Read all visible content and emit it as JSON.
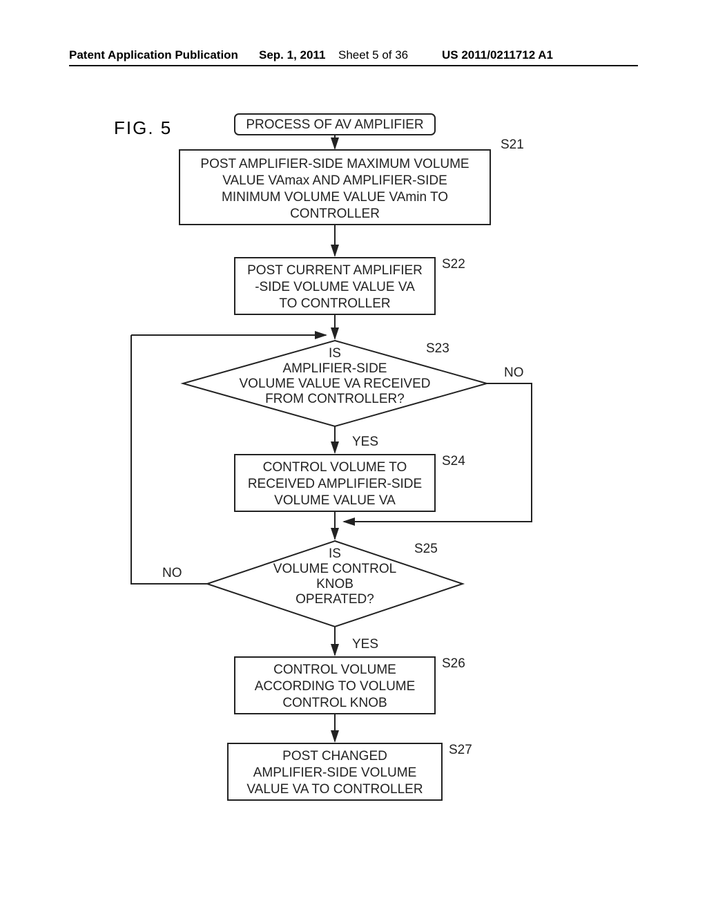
{
  "header": {
    "left": "Patent Application Publication",
    "date": "Sep. 1, 2011",
    "sheet": "Sheet 5 of 36",
    "pubno": "US 2011/0211712 A1"
  },
  "figure_label": "FIG.  5",
  "boxes": {
    "start": "PROCESS OF AV AMPLIFIER",
    "s21": {
      "label": "S21",
      "lines": [
        "POST AMPLIFIER-SIDE MAXIMUM VOLUME",
        "VALUE VAmax AND AMPLIFIER-SIDE",
        "MINIMUM VOLUME VALUE VAmin TO",
        "CONTROLLER"
      ]
    },
    "s22": {
      "label": "S22",
      "lines": [
        "POST CURRENT AMPLIFIER",
        "-SIDE VOLUME VALUE VA",
        "TO CONTROLLER"
      ]
    },
    "s23": {
      "label": "S23",
      "lines": [
        "IS",
        "AMPLIFIER-SIDE",
        "VOLUME VALUE VA RECEIVED",
        "FROM CONTROLLER?"
      ],
      "yes": "YES",
      "no": "NO"
    },
    "s24": {
      "label": "S24",
      "lines": [
        "CONTROL VOLUME TO",
        "RECEIVED AMPLIFIER-SIDE",
        "VOLUME VALUE VA"
      ]
    },
    "s25": {
      "label": "S25",
      "lines": [
        "IS",
        "VOLUME CONTROL",
        "KNOB",
        "OPERATED?"
      ],
      "yes": "YES",
      "no": "NO"
    },
    "s26": {
      "label": "S26",
      "lines": [
        "CONTROL VOLUME",
        "ACCORDING TO VOLUME",
        "CONTROL KNOB"
      ]
    },
    "s27": {
      "label": "S27",
      "lines": [
        "POST CHANGED",
        "AMPLIFIER-SIDE VOLUME",
        "VALUE VA TO CONTROLLER"
      ]
    }
  }
}
